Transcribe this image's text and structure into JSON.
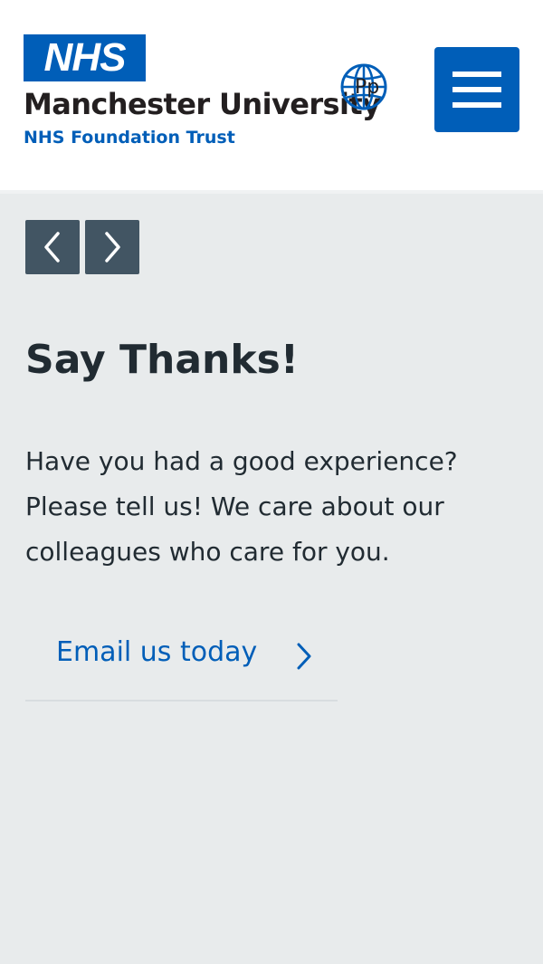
{
  "header": {
    "logo_text": "NHS",
    "org_name": "Manchester University",
    "org_subtitle": "NHS Foundation Trust",
    "translate_label": "Рр",
    "menu_label": "Menu"
  },
  "carousel": {
    "prev_icon": "chevron-left-icon",
    "next_icon": "chevron-right-icon"
  },
  "content": {
    "title": "Say Thanks!",
    "body": "Have you had a good experience? Please tell us! We care about our colleagues who care for you.",
    "cta_label": "Email us today"
  },
  "colors": {
    "nhs_blue": "#005eb8",
    "background": "#e8ebec",
    "header_bg": "#ffffff",
    "carousel_button": "#425563",
    "text": "#212b32"
  }
}
